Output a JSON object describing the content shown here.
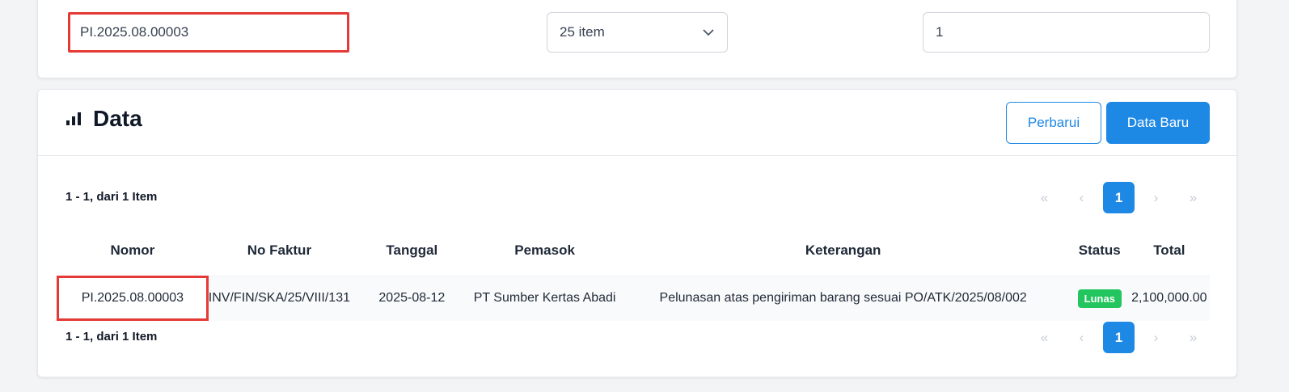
{
  "filter": {
    "search_value": "PI.2025.08.00003",
    "page_size": "25 item",
    "page_number": "1"
  },
  "data_section": {
    "title": "Data",
    "refresh_label": "Perbarui",
    "new_label": "Data Baru",
    "count_text": "1 - 1, dari 1 Item",
    "pagination": {
      "first": "«",
      "prev": "‹",
      "current": "1",
      "next": "›",
      "last": "»"
    },
    "columns": [
      "Nomor",
      "No Faktur",
      "Tanggal",
      "Pemasok",
      "Keterangan",
      "Status",
      "Total"
    ],
    "rows": [
      {
        "nomor": "PI.2025.08.00003",
        "no_faktur": "INV/FIN/SKA/25/VIII/131",
        "tanggal": "2025-08-12",
        "pemasok": "PT Sumber Kertas Abadi",
        "keterangan": "Pelunasan atas pengiriman barang sesuai PO/ATK/2025/08/002",
        "status": "Lunas",
        "total": "2,100,000.00"
      }
    ]
  },
  "colors": {
    "primary": "#1e88e5",
    "success": "#22c55e",
    "highlight": "#e53935"
  },
  "icons": {
    "title_icon": "bar-chart-icon",
    "select_icon": "chevron-down-icon"
  }
}
